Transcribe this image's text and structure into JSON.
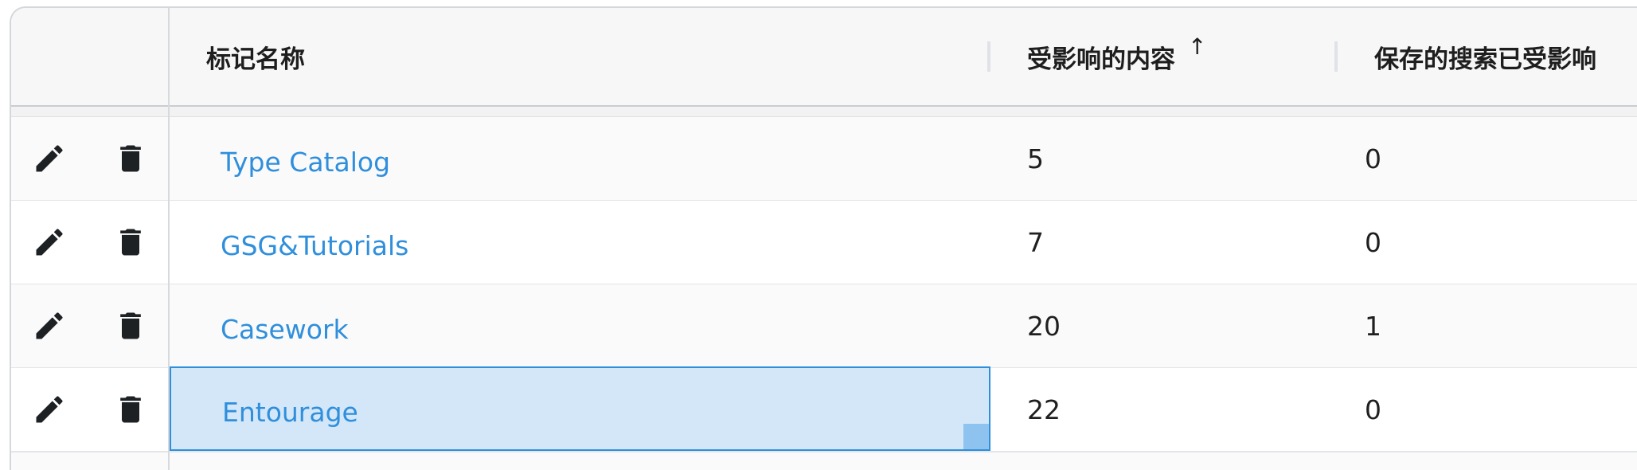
{
  "columns": {
    "name": "标记名称",
    "content": "受影响的内容",
    "saved_search": "保存的搜索已受影响",
    "sort_icon": "↑"
  },
  "rows": [
    {
      "name": "Type Catalog",
      "content": "5",
      "saved_search": "0"
    },
    {
      "name": "GSG&Tutorials",
      "content": "7",
      "saved_search": "0"
    },
    {
      "name": "Casework",
      "content": "20",
      "saved_search": "1"
    },
    {
      "name": "Entourage",
      "content": "22",
      "saved_search": "0"
    }
  ],
  "icons": {
    "edit": "pencil-icon",
    "delete": "trash-icon"
  },
  "colors": {
    "link": "#2f8fdc",
    "selection_bg": "#d3e7f8",
    "selection_border": "#2f8fdc",
    "header_bg": "#f7f7f8"
  },
  "selected_row": 3
}
